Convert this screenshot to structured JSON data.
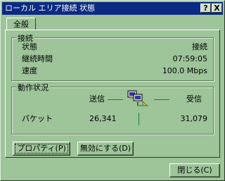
{
  "window": {
    "title": "ローカル エリア接続 状態",
    "help_button": "?",
    "close_button": "X"
  },
  "tabs": [
    {
      "label": "全般"
    }
  ],
  "connection": {
    "group_label": "接続",
    "status_label": "状態",
    "status_value": "接続",
    "duration_label": "継続時間",
    "duration_value": "07:59:05",
    "speed_label": "速度",
    "speed_value": "100.0 Mbps"
  },
  "activity": {
    "group_label": "動作状況",
    "sent_label": "送信",
    "received_label": "受信",
    "packets_label": "パケット",
    "packets_sent": "26,341",
    "packets_received": "31,079"
  },
  "buttons": {
    "properties": "プロパティ(P)",
    "disable": "無効にする(D)",
    "close": "閉じる(C)"
  },
  "colors": {
    "dialog": "#9ec49a",
    "titlebar": "#0a2a83"
  }
}
